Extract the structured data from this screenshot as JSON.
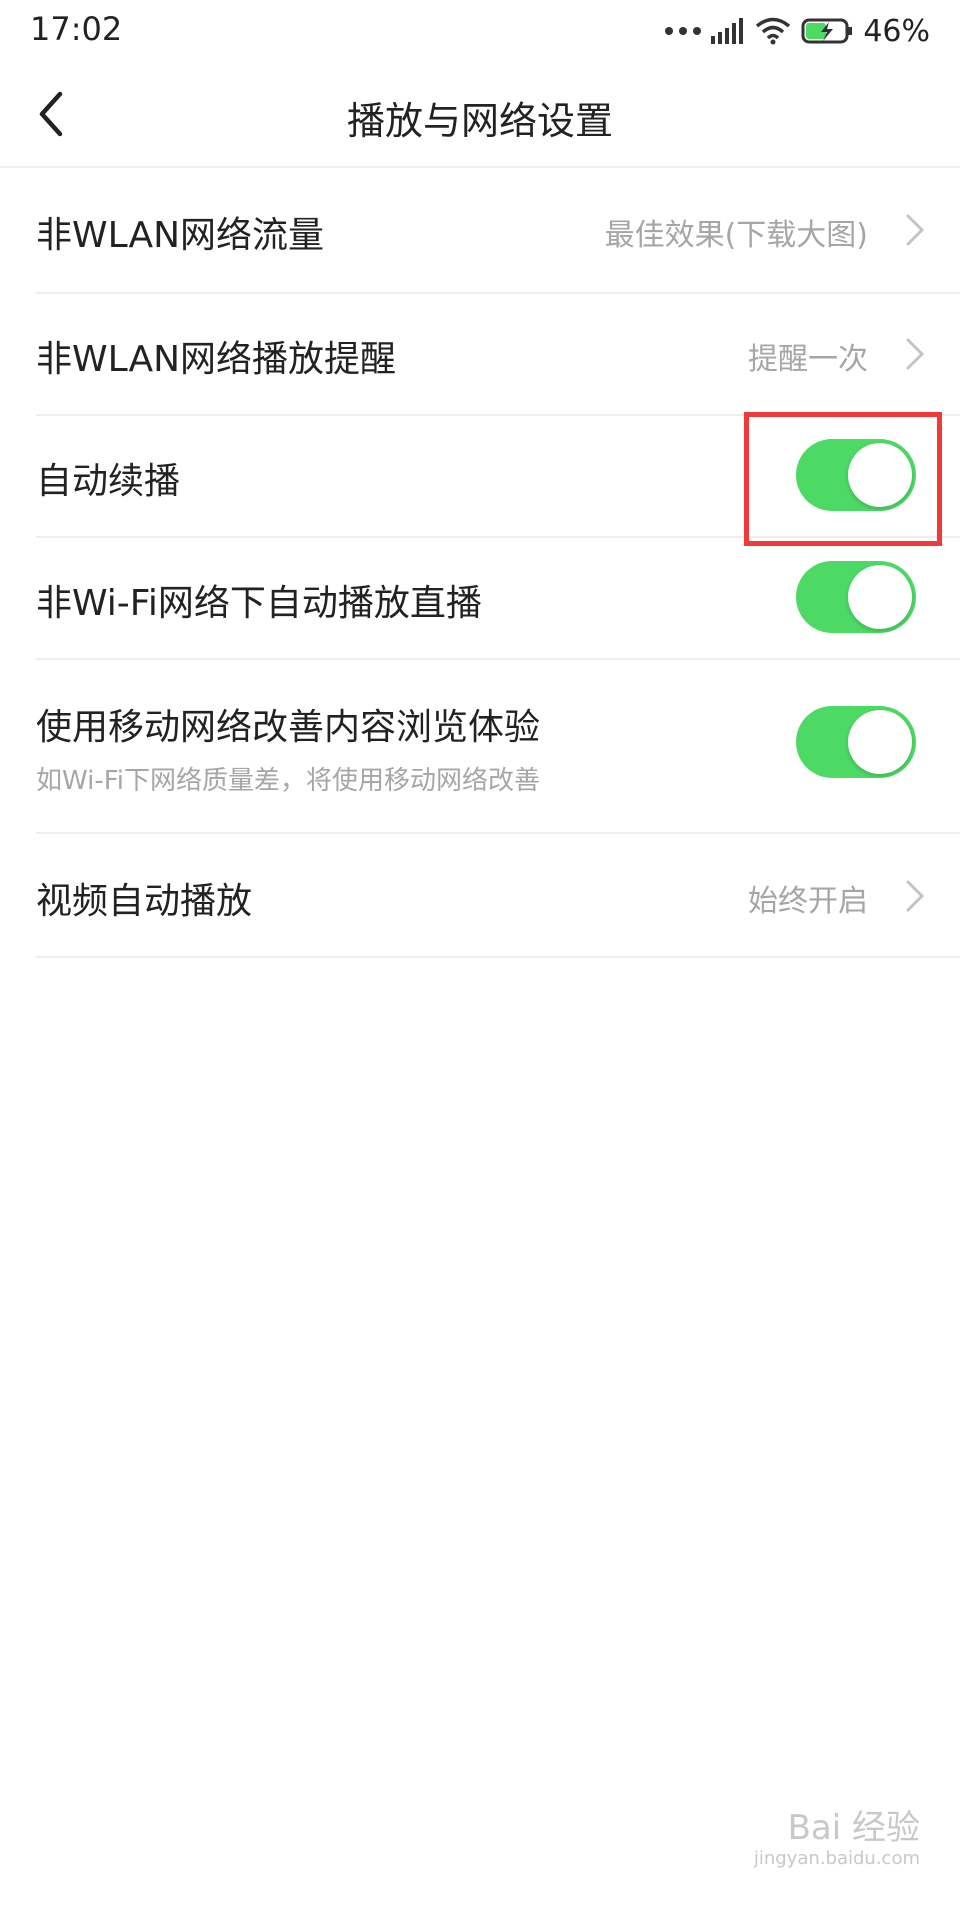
{
  "status_bar": {
    "time": "17:02",
    "battery_percent": "46%",
    "icons": [
      "more-dots-icon",
      "signal-icon",
      "wifi-icon",
      "battery-charging-icon"
    ]
  },
  "nav": {
    "back_icon": "chevron-left-icon",
    "title": "播放与网络设置"
  },
  "settings": {
    "data_traffic": {
      "label": "非WLAN网络流量",
      "value": "最佳效果(下载大图)"
    },
    "play_reminder": {
      "label": "非WLAN网络播放提醒",
      "value": "提醒一次"
    },
    "auto_continue": {
      "label": "自动续播",
      "enabled": true
    },
    "live_autoplay": {
      "label": "非Wi-Fi网络下自动播放直播",
      "enabled": true
    },
    "mobile_improve": {
      "label": "使用移动网络改善内容浏览体验",
      "sub": "如Wi-Fi下网络质量差，将使用移动网络改善",
      "enabled": true
    },
    "video_autoplay": {
      "label": "视频自动播放",
      "value": "始终开启"
    }
  },
  "colors": {
    "toggle_on": "#4cd964",
    "highlight": "#f03a3a",
    "secondary_text": "#a6a6a6"
  },
  "watermark": {
    "main": "Bai 经验",
    "sub": "jingyan.baidu.com"
  }
}
